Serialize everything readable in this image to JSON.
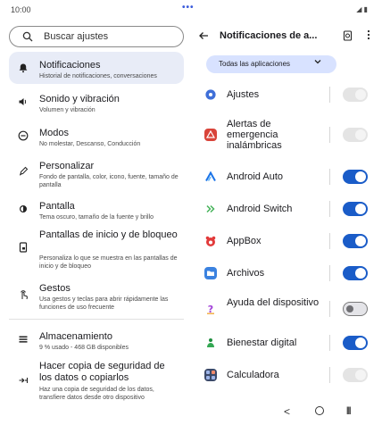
{
  "status_bar": {
    "time": "10:00",
    "dots": "•••",
    "icons": "◢ ▮"
  },
  "search": {
    "label": "Buscar ajustes"
  },
  "settings": [
    {
      "icon": "bell-icon",
      "glyph": "🔔",
      "title": "Notificaciones",
      "subtitle": "Historial de notificaciones, conversaciones",
      "selected": true
    },
    {
      "icon": "volume-icon",
      "glyph": "🔊",
      "title": "Sonido y vibración",
      "subtitle": "Volumen y vibración"
    },
    {
      "icon": "do-not-disturb-icon",
      "glyph": "⊖",
      "title": "Modos",
      "subtitle": "No molestar, Descanso, Conducción"
    },
    {
      "icon": "palette-icon",
      "glyph": "✎",
      "title": "Personalizar",
      "subtitle": "Fondo de pantalla, color, icono, fuente, tamaño de pantalla"
    },
    {
      "icon": "brightness-icon",
      "glyph": "☼",
      "title": "Pantalla",
      "subtitle": "Tema oscuro, tamaño de la fuente y brillo"
    },
    {
      "icon": "lock-screen-icon",
      "glyph": "▯",
      "title": "Pantallas de inicio y de bloqueo",
      "subtitle": "Personaliza lo que se muestra en las pantallas de inicio y de bloqueo"
    },
    {
      "icon": "gesture-icon",
      "glyph": "☝",
      "title": "Gestos",
      "subtitle": "Usa gestos y teclas para abrir rápidamente las funciones de uso frecuente"
    },
    {
      "icon": "storage-icon",
      "glyph": "≡",
      "title": "Almacenamiento",
      "subtitle": "9 % usado - 468 GB disponibles"
    },
    {
      "icon": "backup-transfer-icon",
      "glyph": "⇄",
      "title": "Hacer copia de seguridad de los datos o copiarlos",
      "subtitle": "Haz una copia de seguridad de los datos, transfiere datos desde otro dispositivo"
    }
  ],
  "right_pane": {
    "title": "Notificaciones de a...",
    "filter_label": "Todas las aplicaciones",
    "apps": [
      {
        "name": "Ajustes",
        "icon": "gear-icon",
        "glyph": "⚙",
        "color": "#4a72d8",
        "state": "disabled"
      },
      {
        "name": "Alertas de emergencia inalámbricas",
        "icon": "warning-icon",
        "glyph": "▲",
        "color": "#d9443a",
        "state": "disabled"
      },
      {
        "name": "Android Auto",
        "icon": "android-auto-icon",
        "glyph": "∧",
        "color": "#ffffff",
        "state": "on"
      },
      {
        "name": "Android Switch",
        "icon": "android-switch-icon",
        "glyph": "»",
        "color": "#ffffff",
        "state": "on"
      },
      {
        "name": "AppBox",
        "icon": "appbox-icon",
        "glyph": "●",
        "color": "#e23a3a",
        "state": "on"
      },
      {
        "name": "Archivos",
        "icon": "folder-icon",
        "glyph": "▬",
        "color": "#3b82e0",
        "state": "on"
      },
      {
        "name": "Ayuda del dispositivo",
        "icon": "help-icon",
        "glyph": "?",
        "color": "#ffffff",
        "state": "off"
      },
      {
        "name": "Bienestar digital",
        "icon": "wellbeing-icon",
        "glyph": "♣",
        "color": "#ffffff",
        "state": "on"
      },
      {
        "name": "Calculadora",
        "icon": "calculator-icon",
        "glyph": "±",
        "color": "#3c4a6a",
        "state": "disabled"
      }
    ]
  },
  "nav": {
    "back": "<",
    "recent": "|||"
  }
}
